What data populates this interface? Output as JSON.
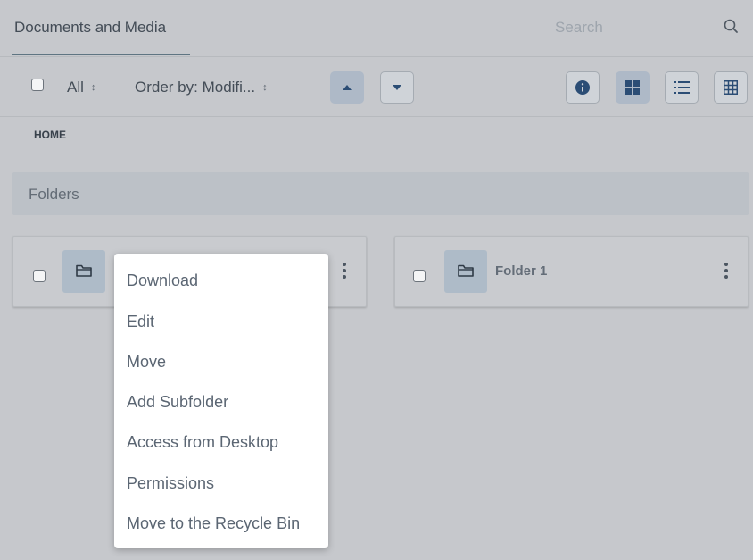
{
  "header": {
    "title": "Documents and Media",
    "search_placeholder": "Search"
  },
  "toolbar": {
    "filter_label": "All",
    "order_label": "Order by: Modifi...",
    "view_modes": [
      "info",
      "cards",
      "list",
      "table"
    ],
    "active_view": "cards"
  },
  "breadcrumb": {
    "home": "HOME"
  },
  "sections": {
    "folders": "Folders"
  },
  "folders": [
    {
      "title": ""
    },
    {
      "title": "Folder 1"
    }
  ],
  "context_menu": {
    "items": [
      "Download",
      "Edit",
      "Move",
      "Add Subfolder",
      "Access from Desktop",
      "Permissions",
      "Move to the Recycle Bin"
    ]
  },
  "icons": {
    "search": "search-icon",
    "sort_up": "caret-up-icon",
    "sort_down": "caret-down-icon",
    "info": "info-icon",
    "cards": "cards-icon",
    "list": "list-icon",
    "table": "table-icon",
    "folder": "folder-icon",
    "actions": "ellipsis-v-icon"
  },
  "colors": {
    "accent": "#2b4d75",
    "overlay": "#c6c8cc",
    "menu_bg": "#ffffff"
  }
}
